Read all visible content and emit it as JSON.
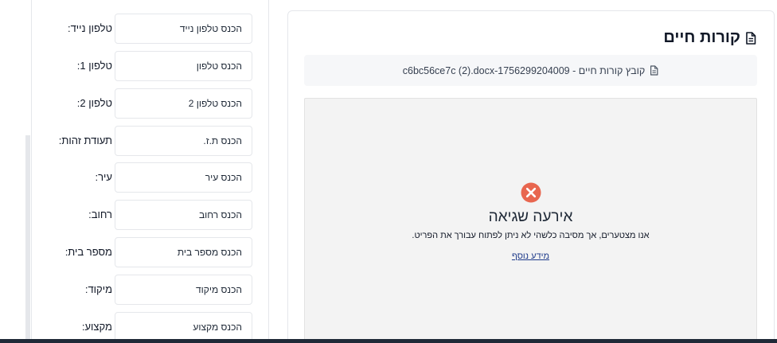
{
  "form": {
    "fields": [
      {
        "label": "טלפון נייד:",
        "placeholder": "הכנס טלפון נייד"
      },
      {
        "label": "טלפון 1:",
        "placeholder": "הכנס טלפון"
      },
      {
        "label": "טלפון 2:",
        "placeholder": "הכנס טלפון 2"
      },
      {
        "label": "תעודת זהות:",
        "placeholder": "הכנס ת.ז."
      },
      {
        "label": "עיר:",
        "placeholder": "הכנס עיר"
      },
      {
        "label": "רחוב:",
        "placeholder": "הכנס רחוב"
      },
      {
        "label": "מספר בית:",
        "placeholder": "הכנס מספר בית"
      },
      {
        "label": "מיקוד:",
        "placeholder": "הכנס מיקוד"
      },
      {
        "label": "מקצוע:",
        "placeholder": "הכנס מקצוע"
      }
    ]
  },
  "resume": {
    "title": "קורות חיים",
    "title_icon": "document-icon",
    "file_label": "קובץ קורות חיים - c6bc56ce7c (2).docx-1756299204009",
    "file_icon": "document-icon",
    "viewer": {
      "error_icon": "error-x-circle-icon",
      "error_color": "#e8664f",
      "error_title": "אירעה שגיאה",
      "error_message": "אנו מצטערים, אך מסיבה כלשהי לא ניתן לפתוח עבורך את הפריט.",
      "more_info_link": "מידע נוסף"
    }
  }
}
